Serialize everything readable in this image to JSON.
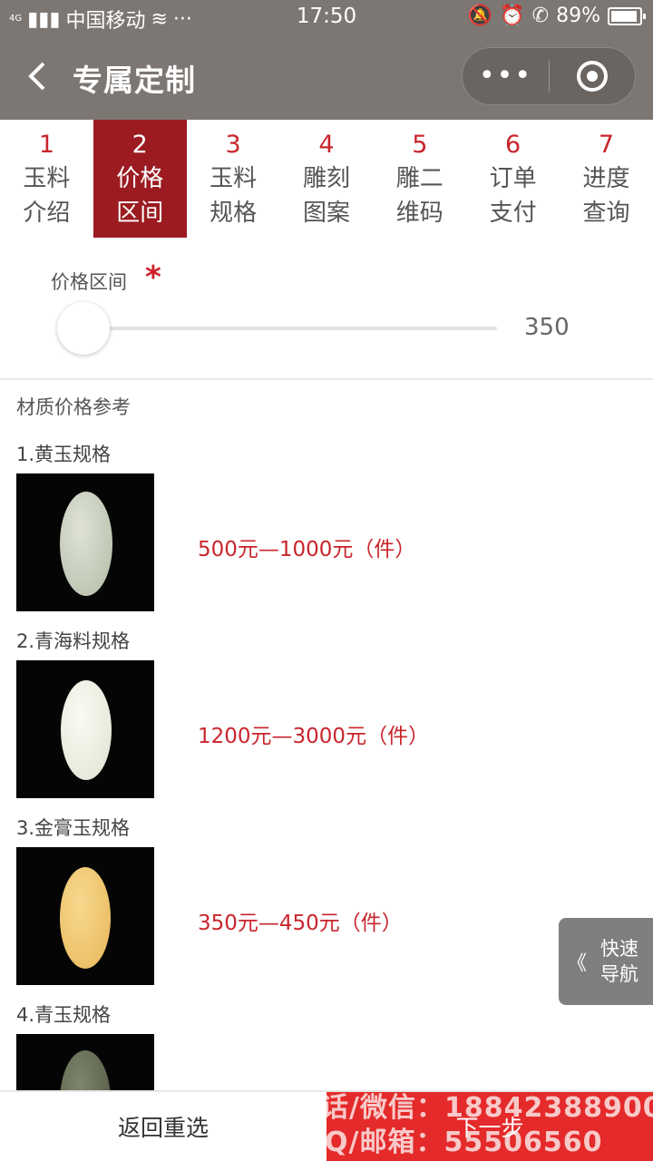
{
  "status_bar": {
    "carrier": "中国移动",
    "signal": "4G",
    "more": "···",
    "time": "17:50",
    "battery": "89%",
    "icons": [
      "bell-off-icon",
      "alarm-icon",
      "call-hd-icon",
      "battery-icon",
      "wifi-icon"
    ]
  },
  "nav": {
    "title": "专属定制",
    "more_icon": "•••",
    "colors": {
      "bar": "#7d7773",
      "capsule": "#6a6561"
    }
  },
  "steps": [
    {
      "num": "1",
      "label": "玉料介绍"
    },
    {
      "num": "2",
      "label": "价格区间",
      "active": true
    },
    {
      "num": "3",
      "label": "玉料规格"
    },
    {
      "num": "4",
      "label": "雕刻图案"
    },
    {
      "num": "5",
      "label": "雕二维码"
    },
    {
      "num": "6",
      "label": "订单支付"
    },
    {
      "num": "7",
      "label": "进度查询"
    }
  ],
  "price": {
    "label": "价格区间",
    "required": "*",
    "value": "350",
    "slider_level": 0
  },
  "reference": {
    "title": "材质价格参考",
    "items": [
      {
        "title": "1.黄玉规格",
        "price": "500元—1000元（件）",
        "stone_color": "#c9d0bf"
      },
      {
        "title": "2.青海料规格",
        "price": "1200元—3000元（件）",
        "stone_color": "#f0f1e6"
      },
      {
        "title": "3.金膏玉规格",
        "price": "350元—450元（件）",
        "stone_color": "#f1c979"
      },
      {
        "title": "4.青玉规格",
        "price": "",
        "stone_color": "#606650"
      }
    ]
  },
  "quick_nav": {
    "chevron": "《",
    "label": "快速导航"
  },
  "bottom": {
    "reselect": "返回重选",
    "next": "下一步",
    "watermark_line1": "话/微信：18842388900",
    "watermark_line2": "Q/邮箱：55506560"
  },
  "colors": {
    "accent": "#c9252c",
    "active_step": "#9b1b21",
    "next_button": "#e42a2a"
  }
}
